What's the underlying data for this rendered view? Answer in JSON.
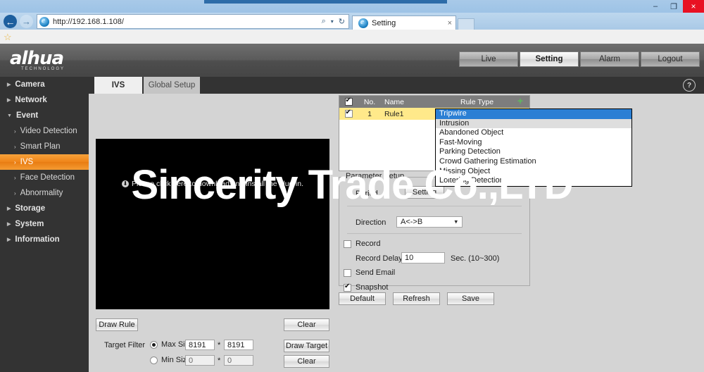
{
  "browser": {
    "url": "http://192.168.1.108/",
    "tab_title": "Setting",
    "tab_close": "×",
    "back_icon": "←",
    "forward_icon": "→",
    "search_icon": "⌕",
    "dropdown_icon": "▾",
    "refresh_icon": "↻",
    "home_icon": "⌂",
    "favorites_icon": "★",
    "tools_icon": "⚙",
    "minimize": "–",
    "maximize": "❐",
    "close": "×",
    "bookmark_star": "☆"
  },
  "header": {
    "logo_text": "alhua",
    "logo_sub": "TECHNOLOGY",
    "nav": [
      {
        "label": "Live",
        "active": false
      },
      {
        "label": "Setting",
        "active": true
      },
      {
        "label": "Alarm",
        "active": false
      },
      {
        "label": "Logout",
        "active": false
      }
    ]
  },
  "sidebar": {
    "items": [
      {
        "label": "Camera",
        "level": 1,
        "arrow": "▶",
        "selected": false
      },
      {
        "label": "Network",
        "level": 1,
        "arrow": "▶",
        "selected": false
      },
      {
        "label": "Event",
        "level": 1,
        "arrow": "▼",
        "selected": false
      },
      {
        "label": "Video Detection",
        "level": 2,
        "arrow": "›",
        "selected": false
      },
      {
        "label": "Smart Plan",
        "level": 2,
        "arrow": "›",
        "selected": false
      },
      {
        "label": "IVS",
        "level": 2,
        "arrow": "›",
        "selected": true
      },
      {
        "label": "Face Detection",
        "level": 2,
        "arrow": "›",
        "selected": false
      },
      {
        "label": "Abnormality",
        "level": 2,
        "arrow": "›",
        "selected": false
      },
      {
        "label": "Storage",
        "level": 1,
        "arrow": "▶",
        "selected": false
      },
      {
        "label": "System",
        "level": 1,
        "arrow": "▶",
        "selected": false
      },
      {
        "label": "Information",
        "level": 1,
        "arrow": "▶",
        "selected": false
      }
    ]
  },
  "content_tabs": {
    "active": "IVS",
    "inactive": "Global Setup",
    "help_icon": "?"
  },
  "video": {
    "message": "Please click here to download and install the plug-in.",
    "download_icon": "⬇"
  },
  "left_controls": {
    "draw_rule": "Draw Rule",
    "clear_rule": "Clear",
    "target_filter_label": "Target Filter",
    "max_size_label": "Max Size",
    "max_size_w": "8191",
    "max_size_h": "8191",
    "min_size_label": "Min Size",
    "min_size_w": "0",
    "min_size_h": "0",
    "size_separator": "*",
    "draw_target": "Draw Target",
    "clear_target": "Clear",
    "max_selected": true,
    "min_selected": false
  },
  "rule_table": {
    "headers": {
      "check": "",
      "no": "No.",
      "name": "Name",
      "rule_type": "Rule Type"
    },
    "add_icon": "+",
    "header_checked": true,
    "rows": [
      {
        "checked": true,
        "no": "1",
        "name": "Rule1",
        "rule_type": "Tripwire"
      }
    ]
  },
  "rule_type_dropdown": {
    "open": true,
    "options": [
      {
        "label": "Tripwire",
        "state": "selected"
      },
      {
        "label": "Intrusion",
        "state": "hover"
      },
      {
        "label": "Abandoned Object",
        "state": "normal"
      },
      {
        "label": "Fast-Moving",
        "state": "normal"
      },
      {
        "label": "Parking Detection",
        "state": "normal"
      },
      {
        "label": "Crowd Gathering Estimation",
        "state": "normal"
      },
      {
        "label": "Missing Object",
        "state": "normal"
      },
      {
        "label": "Loitering Detection",
        "state": "normal"
      }
    ]
  },
  "parameter_setup": {
    "legend": "Parameter Setup",
    "period_label": "Period",
    "period_button": "Setting",
    "direction_label": "Direction",
    "direction_value": "A<->B",
    "direction_caret": "▾",
    "record_label": "Record",
    "record_checked": false,
    "record_delay_label": "Record Delay",
    "record_delay_value": "10",
    "record_delay_unit": "Sec. (10~300)",
    "send_email_label": "Send Email",
    "send_email_checked": false,
    "snapshot_label": "Snapshot",
    "snapshot_checked": true
  },
  "footer_buttons": {
    "default": "Default",
    "refresh": "Refresh",
    "save": "Save"
  },
  "watermark": {
    "text": "Sincerity Trade Co.,LTD"
  },
  "colors": {
    "accent_orange": "#ef8418",
    "row_highlight": "#ffe98a",
    "dropdown_selected": "#2b7fd4",
    "app_dark": "#333333",
    "panel_gray": "#d4d4d4",
    "close_red": "#e81123"
  }
}
